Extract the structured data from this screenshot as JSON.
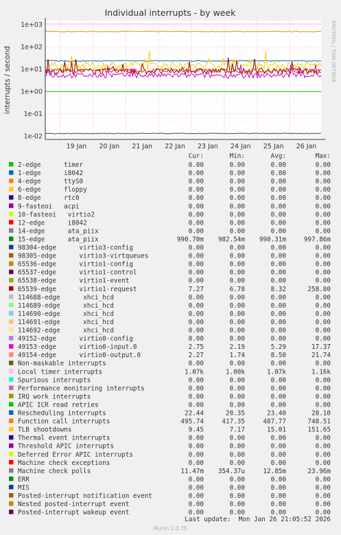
{
  "chart_data": {
    "type": "line",
    "title": "Individual interrupts - by week",
    "ylabel": "interrupts / second",
    "yscale": "log",
    "ylim": [
      0.007,
      1500
    ],
    "yticks": [
      "1e+03",
      "1e+02",
      "1e+01",
      "1e+00",
      "1e-01",
      "1e-02"
    ],
    "ytick_values": [
      1000,
      100,
      10,
      1,
      0.1,
      0.01
    ],
    "x_days": [
      "19 Jan",
      "20 Jan",
      "21 Jan",
      "22 Jan",
      "23 Jan",
      "24 Jan",
      "25 Jan",
      "26 Jan"
    ],
    "side_text": "RRDTOOL / TOBI OETIKER",
    "background": "#ffffff",
    "grid": true,
    "series_profiles": [
      {
        "name": "Local timer interrupts",
        "color": "#ffbbff",
        "level": 1070,
        "jitter": 0.01
      },
      {
        "name": "Function call interrupts",
        "color": "#ea8f00",
        "level": 487.77,
        "jitter": 0.04
      },
      {
        "name": "Rescheduling interrupts",
        "color": "#0066b3",
        "level": 23.4,
        "jitter": 0.05
      },
      {
        "name": "TLB shootdowns",
        "color": "#ffcc00",
        "level": 15.01,
        "jitter": 0.35
      },
      {
        "name": "65539-edge virtio1-request",
        "color": "#990000",
        "level": 8.32,
        "jitter": 0.3
      },
      {
        "name": "49153-edge virtio0-input.0",
        "color": "#cc00cc",
        "level": 5.29,
        "jitter": 0.25
      },
      {
        "name": "49154-edge virtio0-output.0",
        "color": "#cc3300",
        "level": 8.5,
        "jitter": 0.2
      },
      {
        "name": "15-edge ata_piix",
        "color": "#00cc00",
        "level": 0.99031,
        "jitter": 0.0
      },
      {
        "name": "Machine check polls",
        "color": "#444444",
        "level": 0.01285,
        "jitter": 0.04
      }
    ],
    "legend": {
      "headers": [
        "Cur:",
        "Min:",
        "Avg:",
        "Max:"
      ],
      "rows": [
        {
          "name": "2-edge      timer",
          "color": "#00cc00",
          "cur": "0.00",
          "min": "0.00",
          "avg": "0.00",
          "max": "0.00"
        },
        {
          "name": "1-edge      i8042",
          "color": "#0066b3",
          "cur": "0.00",
          "min": "0.00",
          "avg": "0.00",
          "max": "0.00"
        },
        {
          "name": "4-edge      ttyS0",
          "color": "#ff8000",
          "cur": "0.00",
          "min": "0.00",
          "avg": "0.00",
          "max": "0.00"
        },
        {
          "name": "6-edge      floppy",
          "color": "#ffcc00",
          "cur": "0.00",
          "min": "0.00",
          "avg": "0.00",
          "max": "0.00"
        },
        {
          "name": "8-edge      rtc0",
          "color": "#330099",
          "cur": "0.00",
          "min": "0.00",
          "avg": "0.00",
          "max": "0.00"
        },
        {
          "name": "9-fasteoi   acpi",
          "color": "#990099",
          "cur": "0.00",
          "min": "0.00",
          "avg": "0.00",
          "max": "0.00"
        },
        {
          "name": "10-fasteoi   virtio2",
          "color": "#ccff00",
          "cur": "0.00",
          "min": "0.00",
          "avg": "0.00",
          "max": "0.00"
        },
        {
          "name": "12-edge      i8042",
          "color": "#ff0000",
          "cur": "0.00",
          "min": "0.00",
          "avg": "0.00",
          "max": "0.00"
        },
        {
          "name": "14-edge      ata_piix",
          "color": "#808080",
          "cur": "0.00",
          "min": "0.00",
          "avg": "0.00",
          "max": "0.00"
        },
        {
          "name": "15-edge      ata_piix",
          "color": "#008f00",
          "cur": "990.70m",
          "min": "982.54m",
          "avg": "990.31m",
          "max": "997.86m"
        },
        {
          "name": "98304-edge      virtio3-config",
          "color": "#00487d",
          "cur": "0.00",
          "min": "0.00",
          "avg": "0.00",
          "max": "0.00"
        },
        {
          "name": "98305-edge      virtio3-virtqueues",
          "color": "#b35a00",
          "cur": "0.00",
          "min": "0.00",
          "avg": "0.00",
          "max": "0.00"
        },
        {
          "name": "65536-edge      virtio1-config",
          "color": "#b38f00",
          "cur": "0.00",
          "min": "0.00",
          "avg": "0.00",
          "max": "0.00"
        },
        {
          "name": "65537-edge      virtio1-control",
          "color": "#6b006b",
          "cur": "0.00",
          "min": "0.00",
          "avg": "0.00",
          "max": "0.00"
        },
        {
          "name": "65538-edge      virtio1-event",
          "color": "#8fb300",
          "cur": "0.00",
          "min": "0.00",
          "avg": "0.00",
          "max": "0.00"
        },
        {
          "name": "65539-edge      virtio1-request",
          "color": "#b30000",
          "cur": "7.27",
          "min": "6.78",
          "avg": "8.32",
          "max": "258.80"
        },
        {
          "name": "114688-edge      xhci_hcd",
          "color": "#bebebe",
          "cur": "0.00",
          "min": "0.00",
          "avg": "0.00",
          "max": "0.00"
        },
        {
          "name": "114689-edge      xhci_hcd",
          "color": "#80ff80",
          "cur": "0.00",
          "min": "0.00",
          "avg": "0.00",
          "max": "0.00"
        },
        {
          "name": "114690-edge      xhci_hcd",
          "color": "#80c9ff",
          "cur": "0.00",
          "min": "0.00",
          "avg": "0.00",
          "max": "0.00"
        },
        {
          "name": "114691-edge      xhci_hcd",
          "color": "#ffc080",
          "cur": "0.00",
          "min": "0.00",
          "avg": "0.00",
          "max": "0.00"
        },
        {
          "name": "114692-edge      xhci_hcd",
          "color": "#ffe680",
          "cur": "0.00",
          "min": "0.00",
          "avg": "0.00",
          "max": "0.00"
        },
        {
          "name": "49152-edge      virtio0-config",
          "color": "#aa80ff",
          "cur": "0.00",
          "min": "0.00",
          "avg": "0.00",
          "max": "0.00"
        },
        {
          "name": "49153-edge      virtio0-input.0",
          "color": "#ee00cc",
          "cur": "2.75",
          "min": "2.19",
          "avg": "5.29",
          "max": "17.37"
        },
        {
          "name": "49154-edge      virtio0-output.0",
          "color": "#ff8080",
          "cur": "2.27",
          "min": "1.74",
          "avg": "8.50",
          "max": "21.74"
        },
        {
          "name": "Non-maskable interrupts",
          "color": "#666600",
          "cur": "0.00",
          "min": "0.00",
          "avg": "0.00",
          "max": "0.00"
        },
        {
          "name": "Local timer interrupts",
          "color": "#ffbbff",
          "cur": "1.07k",
          "min": "1.00k",
          "avg": "1.07k",
          "max": "1.16k"
        },
        {
          "name": "Spurious interrupts",
          "color": "#00ffcc",
          "cur": "0.00",
          "min": "0.00",
          "avg": "0.00",
          "max": "0.00"
        },
        {
          "name": "Performance monitoring interrupts",
          "color": "#cc6699",
          "cur": "0.00",
          "min": "0.00",
          "avg": "0.00",
          "max": "0.00"
        },
        {
          "name": "IRQ work interrupts",
          "color": "#999900",
          "cur": "0.00",
          "min": "0.00",
          "avg": "0.00",
          "max": "0.00"
        },
        {
          "name": "APIC ICR read retries",
          "color": "#00cc00",
          "cur": "0.00",
          "min": "0.00",
          "avg": "0.00",
          "max": "0.00"
        },
        {
          "name": "Rescheduling interrupts",
          "color": "#0066b3",
          "cur": "22.44",
          "min": "20.35",
          "avg": "23.40",
          "max": "28.10"
        },
        {
          "name": "Function call interrupts",
          "color": "#ff8000",
          "cur": "495.74",
          "min": "417.35",
          "avg": "487.77",
          "max": "748.51"
        },
        {
          "name": "TLB shootdowns",
          "color": "#ffcc00",
          "cur": "9.45",
          "min": "7.17",
          "avg": "15.01",
          "max": "151.65"
        },
        {
          "name": "Thermal event interrupts",
          "color": "#330099",
          "cur": "0.00",
          "min": "0.00",
          "avg": "0.00",
          "max": "0.00"
        },
        {
          "name": "Threshold APIC interrupts",
          "color": "#990099",
          "cur": "0.00",
          "min": "0.00",
          "avg": "0.00",
          "max": "0.00"
        },
        {
          "name": "Deferred Error APIC interrupts",
          "color": "#ccff00",
          "cur": "0.00",
          "min": "0.00",
          "avg": "0.00",
          "max": "0.00"
        },
        {
          "name": "Machine check exceptions",
          "color": "#ff0000",
          "cur": "0.00",
          "min": "0.00",
          "avg": "0.00",
          "max": "0.00"
        },
        {
          "name": "Machine check polls",
          "color": "#808080",
          "cur": "11.47m",
          "min": "354.37u",
          "avg": "12.85m",
          "max": "23.96m"
        },
        {
          "name": "ERR",
          "color": "#008f00",
          "cur": "0.00",
          "min": "0.00",
          "avg": "0.00",
          "max": "0.00"
        },
        {
          "name": "MIS",
          "color": "#00487d",
          "cur": "0.00",
          "min": "0.00",
          "avg": "0.00",
          "max": "0.00"
        },
        {
          "name": "Posted-interrupt notification event",
          "color": "#b35a00",
          "cur": "0.00",
          "min": "0.00",
          "avg": "0.00",
          "max": "0.00"
        },
        {
          "name": "Nested posted-interrupt event",
          "color": "#b38f00",
          "cur": "0.00",
          "min": "0.00",
          "avg": "0.00",
          "max": "0.00"
        },
        {
          "name": "Posted-interrupt wakeup event",
          "color": "#6b006b",
          "cur": "0.00",
          "min": "0.00",
          "avg": "0.00",
          "max": "0.00"
        }
      ]
    },
    "last_update": "Last update:  Mon Jan 26 21:05:52 2026",
    "footer": "Munin 2.0.75"
  }
}
